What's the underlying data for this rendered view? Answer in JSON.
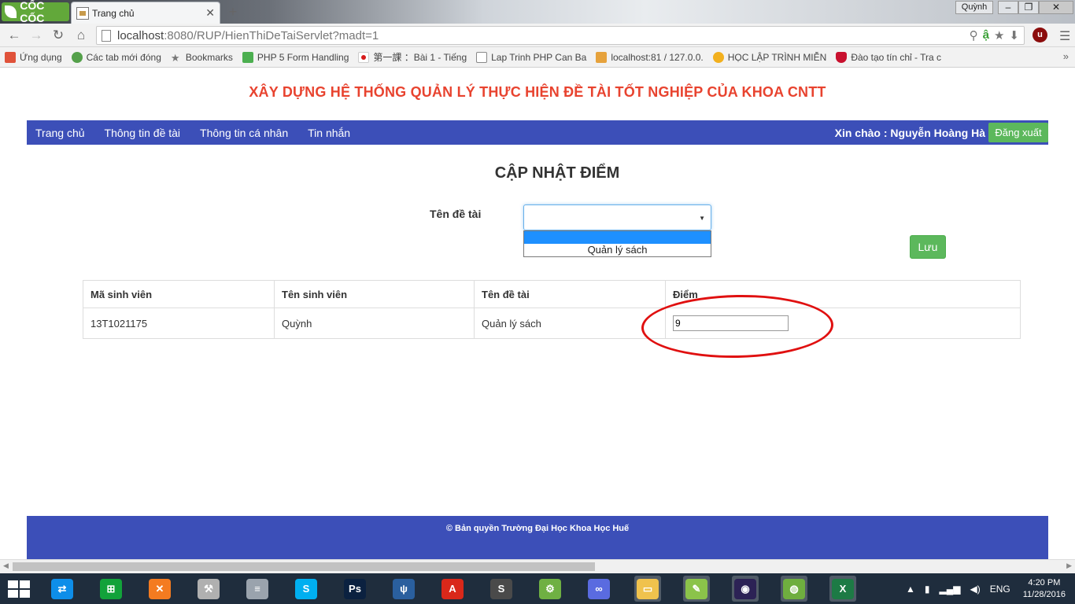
{
  "browser": {
    "brand": "CỐC CỐC",
    "tab_title": "Trang chủ",
    "user_button": "Quỳnh",
    "url_host": "localhost",
    "url_rest": ":8080/RUP/HienThiDeTaiServlet?madt=1",
    "bookmarks": [
      {
        "label": "Ứng dụng",
        "icon": "apps-grid-icon",
        "color": "#e0523a"
      },
      {
        "label": "Các tab mới đóng",
        "icon": "recent-tabs-icon",
        "color": "#54a04a"
      },
      {
        "label": "Bookmarks",
        "icon": "star-icon",
        "color": "#777777"
      },
      {
        "label": "PHP 5 Form Handling",
        "icon": "w3schools-icon",
        "color": "#4caf50"
      },
      {
        "label": "第一課 ：Bài 1 - Tiếng",
        "icon": "japan-flag-icon",
        "color": "#d61a1a"
      },
      {
        "label": "Lap Trinh PHP Can Ba",
        "icon": "page-icon",
        "color": "#888888"
      },
      {
        "label": "localhost:81 / 127.0.0.",
        "icon": "phpmyadmin-icon",
        "color": "#e6a23c"
      },
      {
        "label": "HỌC LẬP TRÌNH MIỄN",
        "icon": "freetuts-icon",
        "color": "#f2b01e"
      },
      {
        "label": "Đào tạo tín chỉ - Tra c",
        "icon": "university-icon",
        "color": "#c8102e"
      }
    ]
  },
  "page": {
    "site_title": "XÂY DỰNG HỆ THỐNG QUẢN LÝ THỰC HIỆN ĐỀ TÀI TỐT NGHIỆP CỦA KHOA CNTT",
    "nav": [
      "Trang chủ",
      "Thông tin đề tài",
      "Thông tin cá nhân",
      "Tin nhắn"
    ],
    "greeting": "Xin chào : Nguyễn Hoàng Hà",
    "logout": "Đăng xuất",
    "heading": "CẬP NHẬT ĐIỂM",
    "topic_label": "Tên đề tài",
    "topic_select_value": "",
    "topic_options": [
      "",
      "Quản lý sách"
    ],
    "save": "Lưu",
    "table": {
      "headers": [
        "Mã sinh viên",
        "Tên sinh viên",
        "Tên đề tài",
        "Điểm"
      ],
      "rows": [
        {
          "id": "13T1021175",
          "name": "Quỳnh",
          "topic": "Quản lý sách",
          "score": "9"
        }
      ]
    },
    "footer": "© Bản quyền Trường Đại Học Khoa Học Huế"
  },
  "taskbar": {
    "apps": [
      {
        "icon": "teamviewer-icon",
        "color": "#0e8ee9",
        "glyph": "⇄"
      },
      {
        "icon": "store-icon",
        "color": "#12a23a",
        "glyph": "⊞"
      },
      {
        "icon": "xampp-icon",
        "color": "#f47b20",
        "glyph": "✕"
      },
      {
        "icon": "tools-icon",
        "color": "#b0b0b0",
        "glyph": "⚒"
      },
      {
        "icon": "database-icon",
        "color": "#9aa3ad",
        "glyph": "≡"
      },
      {
        "icon": "skype-icon",
        "color": "#00aff0",
        "glyph": "S"
      },
      {
        "icon": "photoshop-icon",
        "color": "#0b2140",
        "glyph": "Ps"
      },
      {
        "icon": "sourcetree-icon",
        "color": "#2a5f9e",
        "glyph": "ψ"
      },
      {
        "icon": "acrobat-icon",
        "color": "#d9281a",
        "glyph": "A"
      },
      {
        "icon": "sublime-icon",
        "color": "#4a4a4a",
        "glyph": "S"
      },
      {
        "icon": "android-studio-icon",
        "color": "#6fb043",
        "glyph": "⚙"
      },
      {
        "icon": "infinity-icon",
        "color": "#5a6be0",
        "glyph": "∞"
      },
      {
        "icon": "file-explorer-icon",
        "color": "#f0c24d",
        "glyph": "▭"
      },
      {
        "icon": "notepad-plus-icon",
        "color": "#8bc34a",
        "glyph": "✎"
      },
      {
        "icon": "eclipse-icon",
        "color": "#2c2255",
        "glyph": "◉"
      },
      {
        "icon": "coccoc-icon",
        "color": "#6fae3f",
        "glyph": "◍"
      },
      {
        "icon": "excel-icon",
        "color": "#1d7a45",
        "glyph": "X"
      }
    ],
    "language": "ENG",
    "time": "4:20 PM",
    "date": "11/28/2016"
  }
}
